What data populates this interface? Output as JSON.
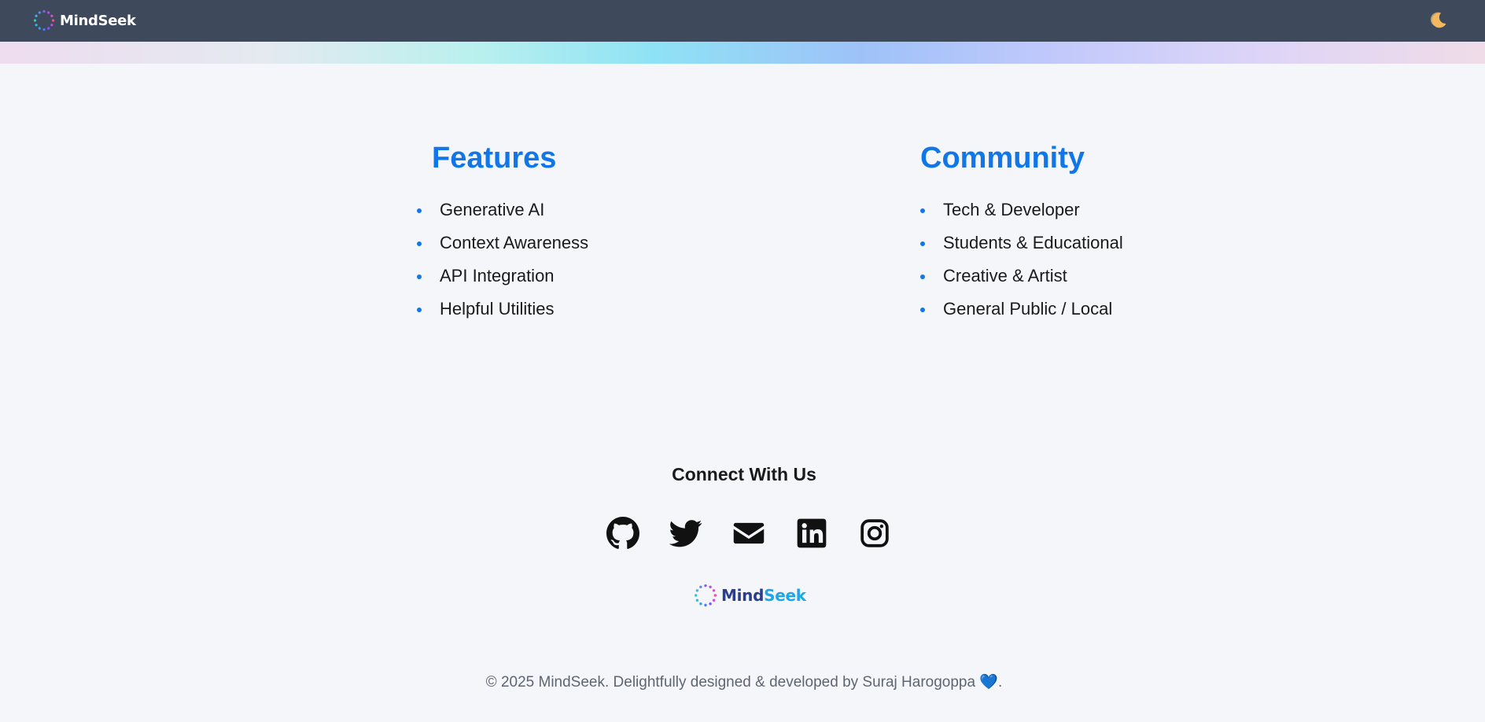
{
  "header": {
    "brand": "MindSeek",
    "theme_toggle_icon": "moon-icon"
  },
  "features": {
    "title": "Features",
    "items": [
      "Generative AI",
      "Context Awareness",
      "API Integration",
      "Helpful Utilities"
    ]
  },
  "community": {
    "title": "Community",
    "items": [
      "Tech & Developer",
      "Students & Educational",
      "Creative & Artist",
      "General Public / Local"
    ]
  },
  "connect": {
    "title": "Connect With Us",
    "icons": [
      "github-icon",
      "twitter-icon",
      "email-icon",
      "linkedin-icon",
      "instagram-icon"
    ]
  },
  "footer": {
    "logo_part1": "Mind",
    "logo_part2": "Seek",
    "copyright": "© 2025 MindSeek. Delightfully designed & developed by Suraj Harogoppa",
    "heart": "💙",
    "trailing": "."
  },
  "colors": {
    "topbar": "#3e4a5b",
    "accent": "#1177e8",
    "background": "#f4f6fa"
  }
}
